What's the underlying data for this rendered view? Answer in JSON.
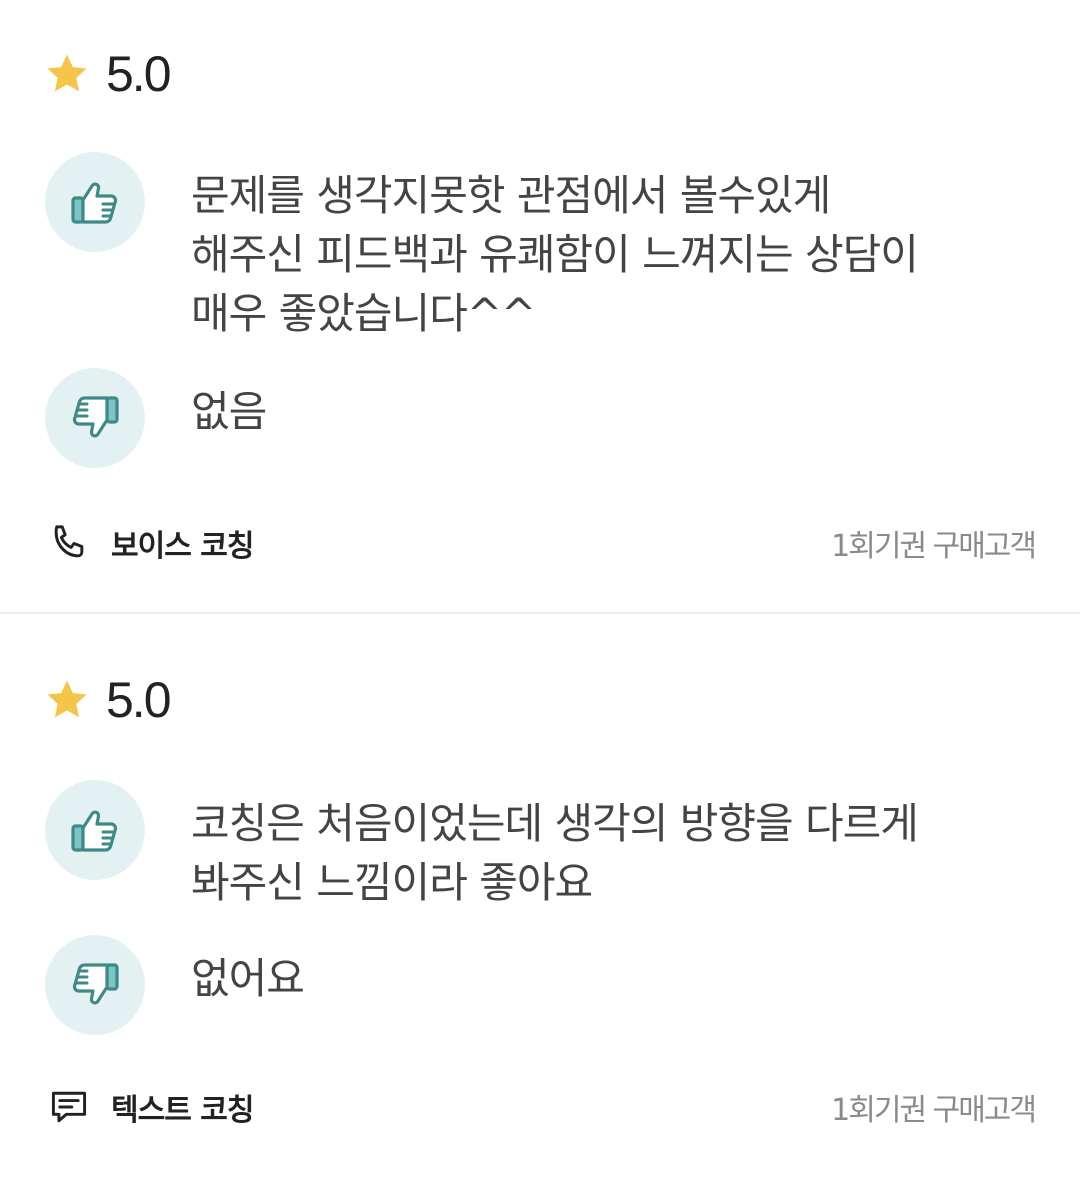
{
  "reviews": [
    {
      "rating": "5.0",
      "good": "문제를 생각지못핫 관점에서 볼수있게\n해주신 피드백과 유쾌함이 느껴지는 상담이\n매우 좋았습니다^^",
      "bad": "없음",
      "coaching_type": "보이스 코칭",
      "coaching_icon": "phone-icon",
      "buyer_label": "1회기권 구매고객"
    },
    {
      "rating": "5.0",
      "good": "코칭은 처음이었는데 생각의 방향을 다르게\n봐주신 느낌이라 좋아요",
      "bad": "없어요",
      "coaching_type": "텍스트 코칭",
      "coaching_icon": "chat-icon",
      "buyer_label": "1회기권 구매고객"
    }
  ],
  "colors": {
    "star": "#F5C54A",
    "icon_bg": "#E3F1F3",
    "icon_stroke": "#3E8A86",
    "thumb_fill": "#7EC4C7",
    "divider": "#ECECEC"
  }
}
